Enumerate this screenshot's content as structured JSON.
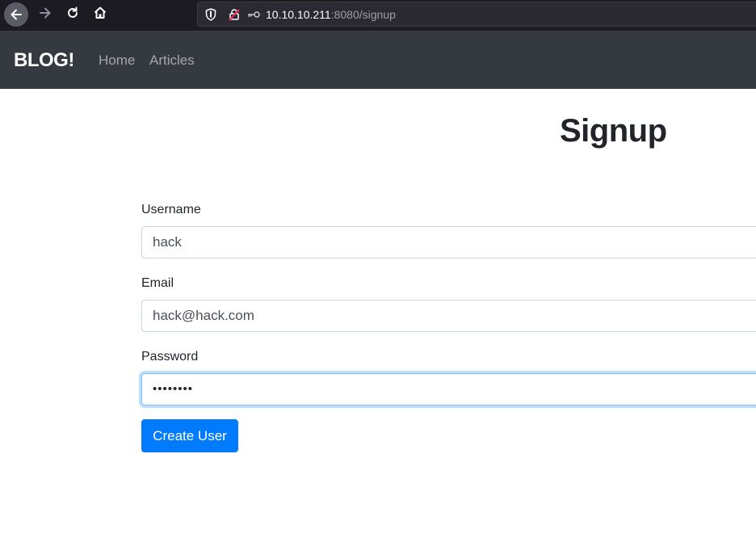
{
  "browser": {
    "url_host": "10.10.10.211",
    "url_rest": ":8080/signup"
  },
  "navbar": {
    "brand": "BLOG!",
    "links": [
      {
        "label": "Home"
      },
      {
        "label": "Articles"
      }
    ]
  },
  "page": {
    "title": "Signup"
  },
  "form": {
    "username": {
      "label": "Username",
      "value": "hack"
    },
    "email": {
      "label": "Email",
      "value": "hack@hack.com"
    },
    "password": {
      "label": "Password",
      "value": "••••••••"
    },
    "submit_label": "Create User"
  },
  "colors": {
    "navbar_bg": "#343a40",
    "primary_button": "#007bff",
    "browser_chrome": "#1c1b22"
  },
  "icons": {
    "back": "arrow-left-icon",
    "forward": "arrow-right-icon",
    "reload": "reload-icon",
    "home": "home-icon",
    "shield": "shield-icon",
    "insecure_lock": "insecure-lock-icon",
    "key": "key-icon"
  }
}
